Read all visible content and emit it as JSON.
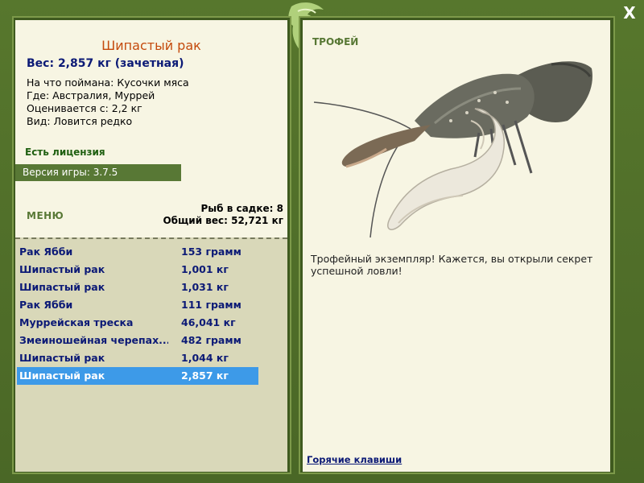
{
  "window": {
    "close_label": "X"
  },
  "fish": {
    "name": "Шипастый рак",
    "weight_line": "Вес: 2,857 кг (зачетная)",
    "bait_line": "На что поймана: Кусочки мяса",
    "location_line": "Где: Австралия, Муррей",
    "rated_line": "Оценивается с: 2,2 кг",
    "kind_line": "Вид: Ловится редко"
  },
  "license": "Есть лицензия",
  "version": "Версия игры: 3.7.5",
  "menu_label": "МЕНЮ",
  "keepnet": {
    "count_line": "Рыб в садке: 8",
    "total_line": "Общий вес: 52,721 кг"
  },
  "catches": [
    {
      "name": "Рак Ябби",
      "weight": "153 грамм"
    },
    {
      "name": "Шипастый рак",
      "weight": "1,001 кг"
    },
    {
      "name": "Шипастый рак",
      "weight": "1,031 кг"
    },
    {
      "name": "Рак Ябби",
      "weight": "111 грамм"
    },
    {
      "name": "Муррейская треска",
      "weight": "46,041 кг"
    },
    {
      "name": "Змеиношейная черепах...",
      "weight": "482 грамм"
    },
    {
      "name": "Шипастый рак",
      "weight": "1,044 кг"
    },
    {
      "name": "Шипастый рак",
      "weight": "2,857 кг"
    }
  ],
  "selected_index": 7,
  "trophy": {
    "label": "ТРОФЕЙ",
    "text": "Трофейный экземпляр! Кажется, вы открыли секрет успешной ловли!"
  },
  "hotkeys_link": "Горячие клавиши",
  "colors": {
    "frame": "#4f6d28",
    "panel_bg": "#f7f5e3",
    "list_bg": "#d9d8b9",
    "title_orange": "#c44a0d",
    "navy_text": "#0c1a76",
    "selected_row": "#3d9ae8"
  },
  "icons": {
    "logo": "fish-logo-icon",
    "close": "close-icon"
  }
}
